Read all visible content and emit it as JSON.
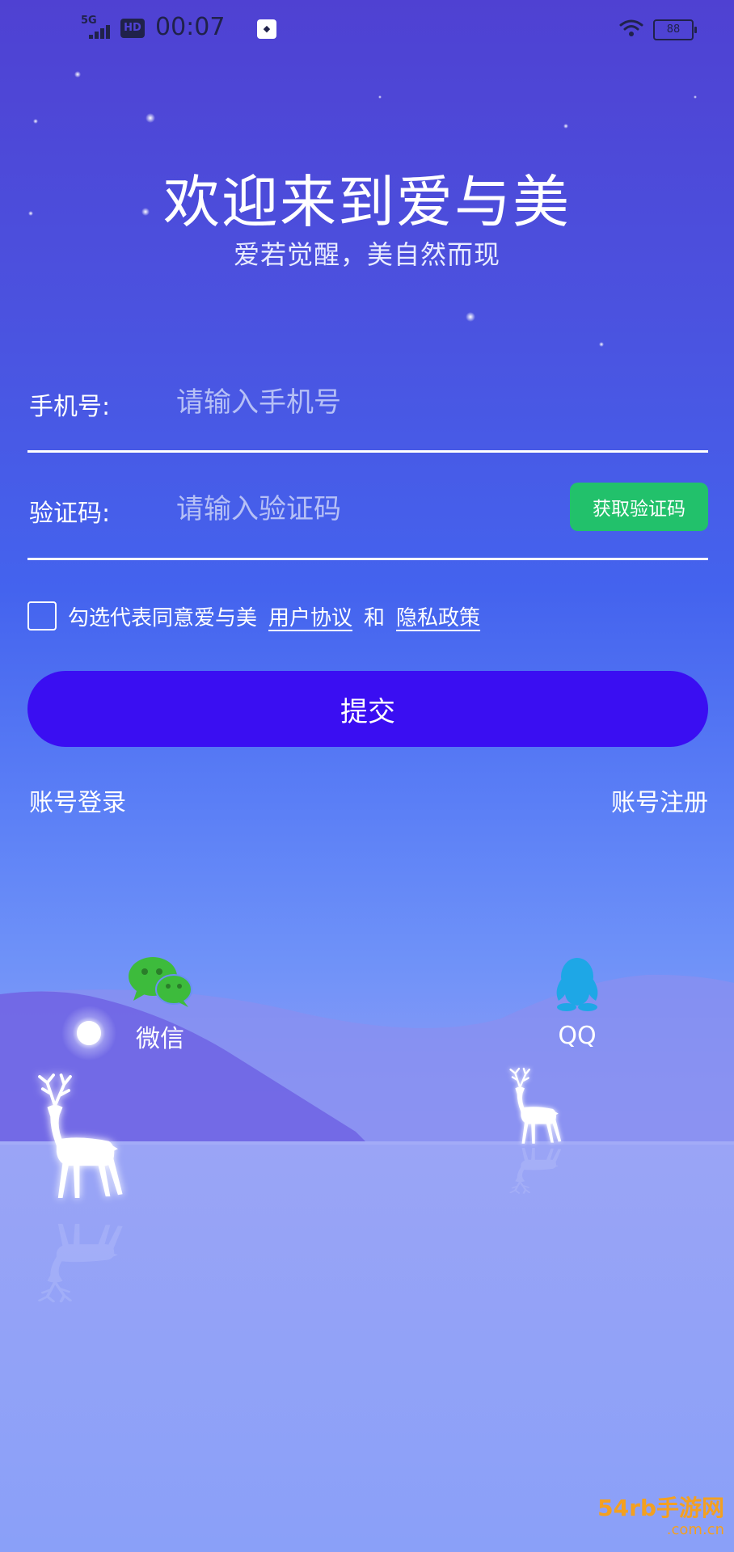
{
  "status_bar": {
    "network": "5G",
    "hd_badge": "HD",
    "time": "00:07",
    "notification_icon": "app-notification-icon",
    "wifi_icon": "wifi-icon",
    "battery": "88"
  },
  "header": {
    "title": "欢迎来到爱与美",
    "subtitle": "爱若觉醒，美自然而现"
  },
  "form": {
    "phone_label": "手机号:",
    "phone_placeholder": "请输入手机号",
    "phone_value": "",
    "code_label": "验证码:",
    "code_placeholder": "请输入验证码",
    "code_value": "",
    "get_code_label": "获取验证码",
    "agreement_text": "勾选代表同意爱与美",
    "user_agreement_link": "用户协议",
    "and_text": "和",
    "privacy_policy_link": "隐私政策",
    "agreement_checked": false,
    "submit_label": "提交"
  },
  "links": {
    "account_login": "账号登录",
    "account_register": "账号注册"
  },
  "social": {
    "wechat_label": "微信",
    "wechat_icon": "wechat-icon",
    "qq_label": "QQ",
    "qq_icon": "qq-icon"
  },
  "watermark": {
    "site": "54rb手游网",
    "domain": ".com.cn"
  },
  "colors": {
    "submit": "#3a0ef2",
    "get_code": "#22c16b",
    "wechat": "#3dbb3c",
    "qq": "#1ea7e6",
    "watermark": "#f4a020"
  }
}
